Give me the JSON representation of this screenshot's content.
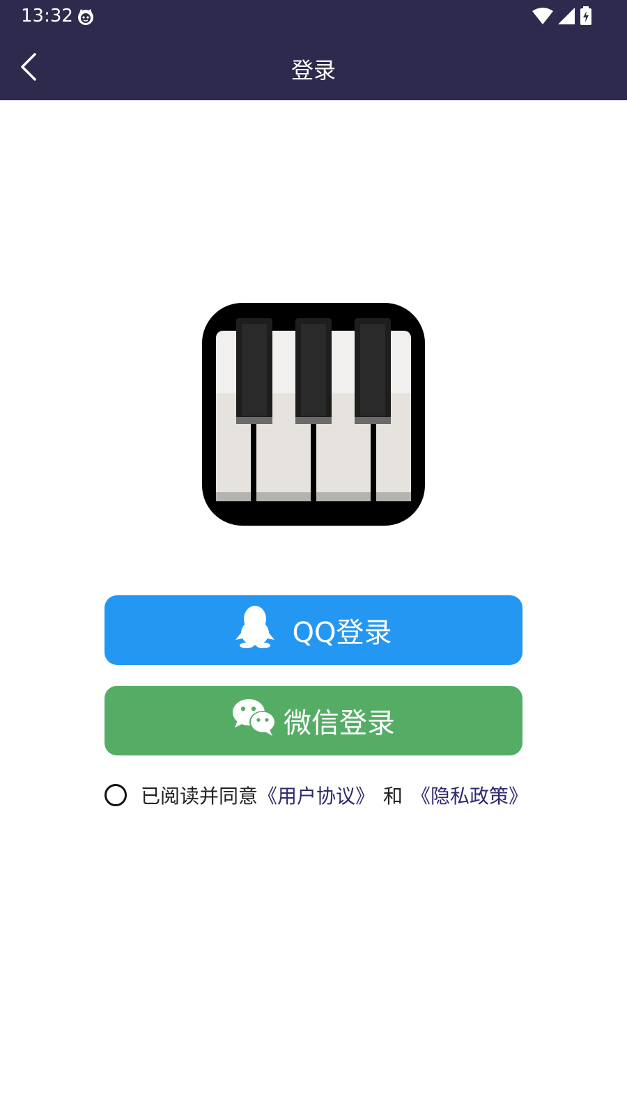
{
  "status_bar": {
    "time": "13:32",
    "icons": [
      "cat-notification-icon",
      "wifi-icon",
      "cell-signal-icon",
      "battery-charging-icon"
    ]
  },
  "nav": {
    "title": "登录",
    "back_icon": "chevron-left-icon"
  },
  "logo": {
    "icon": "piano-keys-icon"
  },
  "buttons": {
    "qq_label": "QQ登录",
    "wechat_label": "微信登录"
  },
  "agreement": {
    "prefix": "已阅读并同意",
    "user_agreement": "《用户协议》",
    "conjunction": "和",
    "privacy_policy": "《隐私政策》",
    "checked": false
  },
  "colors": {
    "header_bg": "#2e2a4e",
    "qq_button": "#2497f3",
    "wechat_button": "#55ad65",
    "link": "#2e2a6e"
  }
}
